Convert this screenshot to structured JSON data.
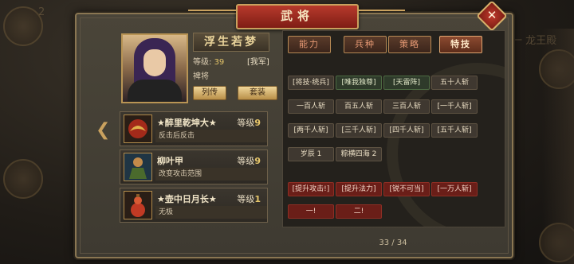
{
  "window_title": "武将",
  "hero": {
    "name": "浮生若梦",
    "level_label": "等级:",
    "level_value": "39",
    "faction": "[我军]",
    "rank": "裨将",
    "biography_button": "列传",
    "suit_button": "套装"
  },
  "skills": [
    {
      "name": "★醉里乾坤大★",
      "level_label": "等级",
      "level": "9",
      "desc": "反击后反击",
      "icon": "dragon-orb-icon"
    },
    {
      "name": "柳叶甲",
      "level_label": "等级",
      "level": "9",
      "desc": "改变攻击范围",
      "icon": "armored-warrior-icon"
    },
    {
      "name": "★壶中日月长★",
      "level_label": "等级",
      "level": "1",
      "desc": "无极",
      "icon": "gourd-icon"
    }
  ],
  "tabs": [
    "能力",
    "兵种",
    "策略",
    "特技"
  ],
  "active_tab": 3,
  "traits": [
    {
      "label": "[将技·统兵]",
      "style": "plain"
    },
    {
      "label": "[唯我独尊]",
      "style": "green"
    },
    {
      "label": "[天雷阵]",
      "style": "green"
    },
    {
      "label": "五十人斩",
      "style": "plain"
    },
    {
      "label": "一百人斩",
      "style": "plain"
    },
    {
      "label": "百五人斩",
      "style": "plain"
    },
    {
      "label": "三百人斩",
      "style": "plain"
    },
    {
      "label": "[一千人斩]",
      "style": "plain"
    },
    {
      "label": "[两千人斩]",
      "style": "plain"
    },
    {
      "label": "[三千人斩]",
      "style": "plain"
    },
    {
      "label": "[四千人斩]",
      "style": "plain"
    },
    {
      "label": "[五千人斩]",
      "style": "plain"
    },
    {
      "label": "岁辰 1",
      "style": "plain"
    },
    {
      "label": "粽横四海 2",
      "style": "plain"
    },
    {
      "label": "[提升攻击!]",
      "style": "red"
    },
    {
      "label": "[提升法力]",
      "style": "red"
    },
    {
      "label": "[锐不可当]",
      "style": "red"
    },
    {
      "label": "[一万人斩]",
      "style": "red"
    },
    {
      "label": "一!",
      "style": "red"
    },
    {
      "label": "二!",
      "style": "red"
    }
  ],
  "pager": "33 / 34",
  "nav": {
    "prev": "❮",
    "next": "❯",
    "close": "✕"
  },
  "background": {
    "top_right_text": "一 龙王殿",
    "top_left_text": "2"
  }
}
